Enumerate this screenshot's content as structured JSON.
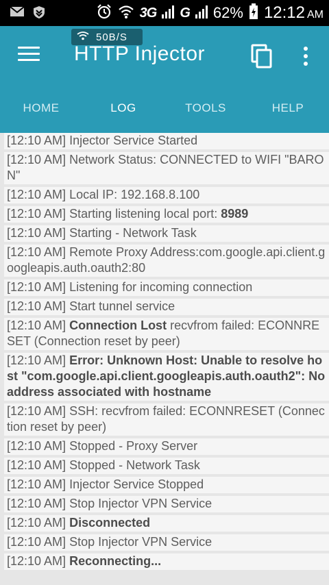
{
  "status_bar": {
    "network_1": "3G",
    "network_2": "G",
    "battery_percent": "62%",
    "time": "12:12",
    "ampm": "AM"
  },
  "app": {
    "speed": "50B/S",
    "title": "HTTP Injector"
  },
  "tabs": [
    {
      "label": "HOME",
      "active": false
    },
    {
      "label": "LOG",
      "active": true
    },
    {
      "label": "TOOLS",
      "active": false
    },
    {
      "label": "HELP",
      "active": false
    }
  ],
  "log": [
    {
      "time": "[12:10 AM]",
      "bold": "",
      "text": "Injector Service Started"
    },
    {
      "time": "[12:10 AM]",
      "bold": "",
      "text": "Network Status: CONNECTED to WIFI \"BARON\""
    },
    {
      "time": "[12:10 AM]",
      "bold": "",
      "text": "Local IP: 192.168.8.100"
    },
    {
      "time": "[12:10 AM]",
      "bold": "",
      "text": "Starting listening local port: ",
      "bold_suffix": "8989"
    },
    {
      "time": "[12:10 AM]",
      "bold": "",
      "text": "Starting - Network Task"
    },
    {
      "time": "[12:10 AM]",
      "bold": "",
      "text": "Remote Proxy Address:com.google.api.client.googleapis.auth.oauth2:80"
    },
    {
      "time": "[12:10 AM]",
      "bold": "",
      "text": "Listening for incoming connection"
    },
    {
      "time": "[12:10 AM]",
      "bold": "",
      "text": "Start tunnel service"
    },
    {
      "time": "[12:10 AM]",
      "bold": "Connection Lost",
      "text": " recvfrom failed: ECONNRESET (Connection reset by peer)"
    },
    {
      "time": "[12:10 AM]",
      "bold": "Error: Unknown Host: Unable to resolve host \"com.google.api.client.googleapis.auth.oauth2\": No address associated with hostname",
      "text": ""
    },
    {
      "time": "[12:10 AM]",
      "bold": "",
      "text": "SSH: recvfrom failed: ECONNRESET (Connection reset by peer)"
    },
    {
      "time": "[12:10 AM]",
      "bold": "",
      "text": "Stopped - Proxy Server"
    },
    {
      "time": "[12:10 AM]",
      "bold": "",
      "text": "Stopped - Network Task"
    },
    {
      "time": "[12:10 AM]",
      "bold": "",
      "text": "Injector Service Stopped"
    },
    {
      "time": "[12:10 AM]",
      "bold": "",
      "text": "Stop Injector VPN Service"
    },
    {
      "time": "[12:10 AM]",
      "bold": "Disconnected",
      "text": ""
    },
    {
      "time": "[12:10 AM]",
      "bold": "",
      "text": "Stop Injector VPN Service"
    },
    {
      "time": "[12:10 AM]",
      "bold": "Reconnecting...",
      "text": ""
    }
  ],
  "colors": {
    "app_bar": "#2a9bb6",
    "status_bar": "#000000",
    "log_background": "#f5f5f5",
    "page_background": "#e6e6e6"
  },
  "icons": [
    "email-icon",
    "shield-download-icon",
    "alarm-icon",
    "wifi-icon",
    "signal-icon",
    "battery-charging-icon",
    "menu-icon",
    "copy-icon",
    "more-vert-icon"
  ]
}
